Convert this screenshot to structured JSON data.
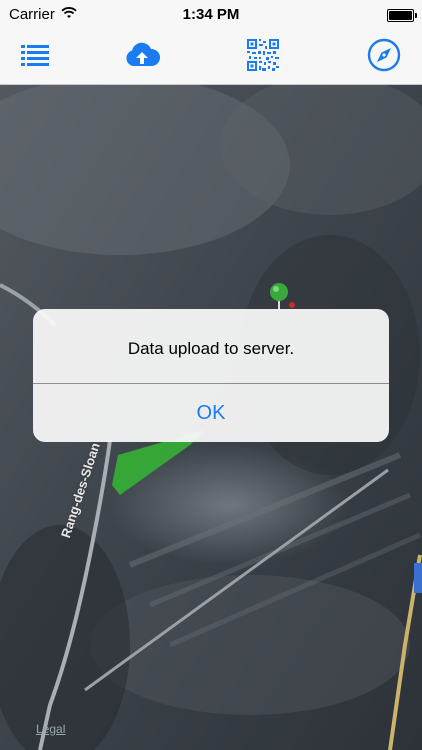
{
  "status_bar": {
    "carrier": "Carrier",
    "time": "1:34 PM",
    "wifi_icon": "wifi-icon",
    "battery_icon": "battery-icon"
  },
  "toolbar": {
    "items": [
      {
        "icon": "list-icon"
      },
      {
        "icon": "cloud-upload-icon"
      },
      {
        "icon": "qr-code-icon"
      },
      {
        "icon": "compass-icon"
      }
    ],
    "accent_color": "#1a7cf0"
  },
  "map": {
    "road_label": "Rang-des-Sloan",
    "legal_label": "Legal",
    "pin_color": "#3aa83a",
    "polygon_color": "#35b035"
  },
  "alert": {
    "message": "Data upload to server.",
    "button_label": "OK"
  }
}
